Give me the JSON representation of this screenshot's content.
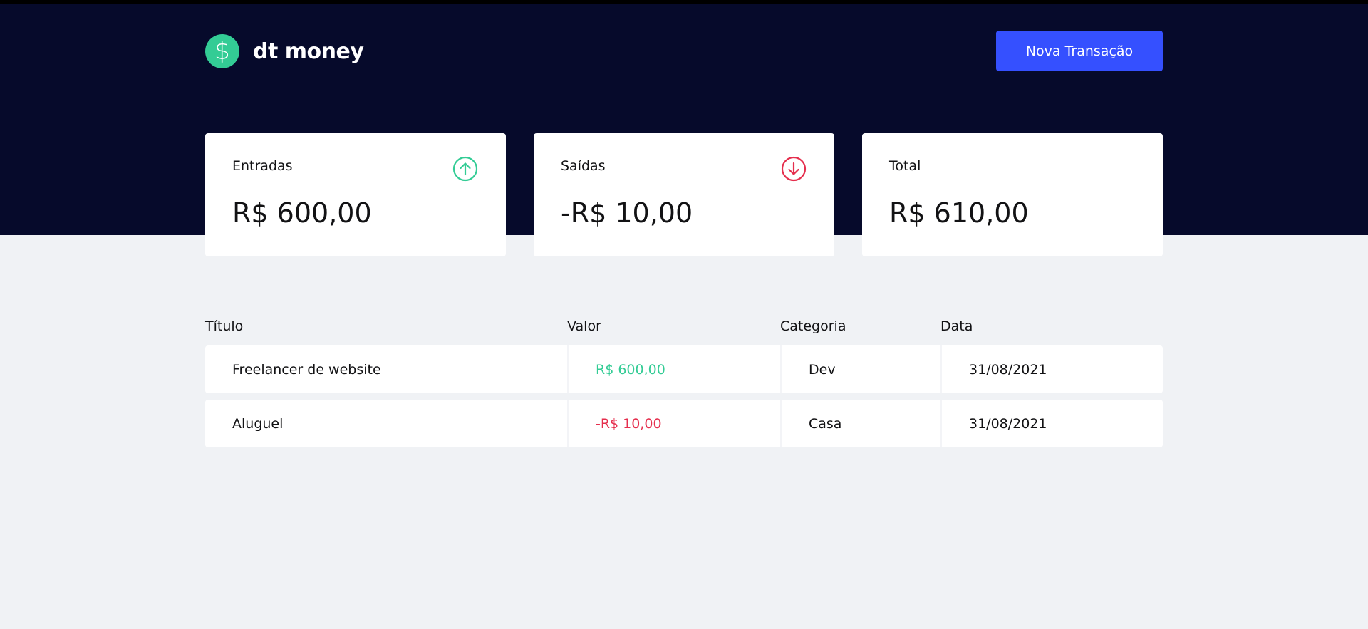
{
  "header": {
    "logo_symbol": "$",
    "app_name": "dt money",
    "new_transaction_label": "Nova Transação"
  },
  "summary": {
    "income": {
      "label": "Entradas",
      "value": "R$ 600,00",
      "icon": "arrow-up-circle-icon",
      "color": "#33cc95"
    },
    "outcome": {
      "label": "Saídas",
      "value": "-R$ 10,00",
      "icon": "arrow-down-circle-icon",
      "color": "#e52e4d"
    },
    "total": {
      "label": "Total",
      "value": "R$ 610,00"
    }
  },
  "table": {
    "headers": [
      "Título",
      "Valor",
      "Categoria",
      "Data"
    ],
    "rows": [
      {
        "title": "Freelancer de website",
        "amount": "R$ 600,00",
        "type": "deposit",
        "category": "Dev",
        "date": "31/08/2021"
      },
      {
        "title": "Aluguel",
        "amount": "-R$ 10,00",
        "type": "withdraw",
        "category": "Casa",
        "date": "31/08/2021"
      }
    ]
  },
  "colors": {
    "header_bg": "#060a2b",
    "page_bg": "#f0f2f5",
    "accent_button": "#3550ff",
    "positive": "#33cc95",
    "negative": "#e52e4d"
  }
}
